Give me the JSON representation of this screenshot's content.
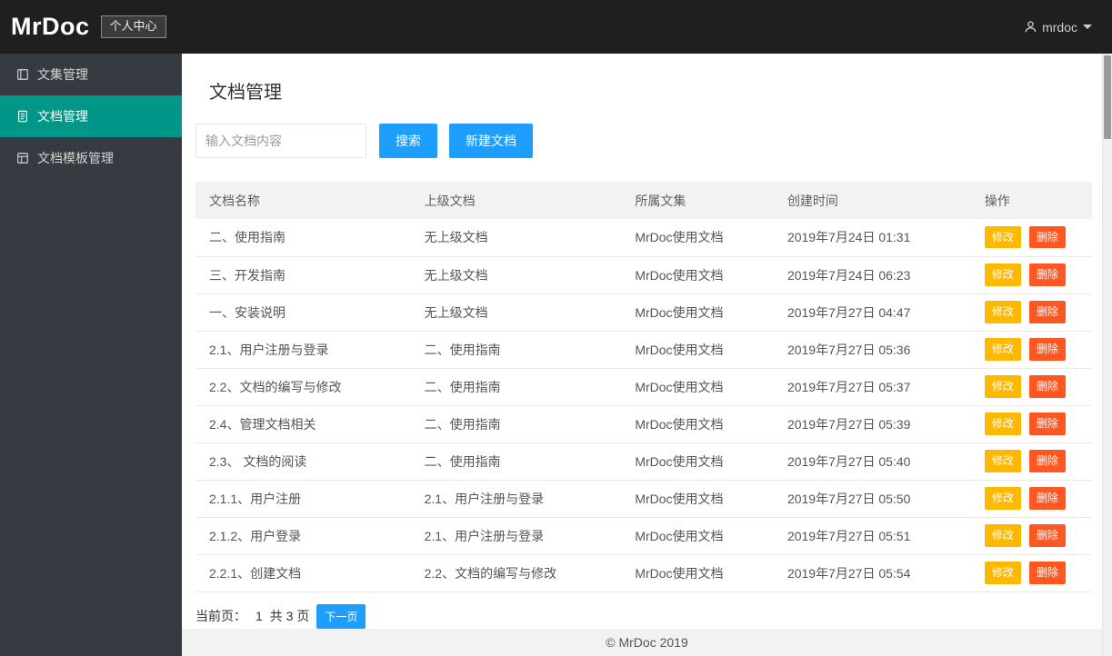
{
  "navbar": {
    "brand": "MrDoc",
    "badge": "个人中心",
    "user": "mrdoc"
  },
  "sidebar": {
    "items": [
      {
        "id": "collections",
        "label": "文集管理",
        "icon": "collection-icon",
        "active": false
      },
      {
        "id": "documents",
        "label": "文档管理",
        "icon": "document-icon",
        "active": true
      },
      {
        "id": "templates",
        "label": "文档模板管理",
        "icon": "template-icon",
        "active": false
      }
    ]
  },
  "main": {
    "title": "文档管理",
    "search": {
      "placeholder": "输入文档内容",
      "search_label": "搜索",
      "new_doc_label": "新建文档"
    },
    "table": {
      "headers": [
        "文档名称",
        "上级文档",
        "所属文集",
        "创建时间",
        "操作"
      ],
      "actions": {
        "edit": "修改",
        "delete": "删除"
      },
      "rows": [
        {
          "name": "二、使用指南",
          "parent": "无上级文档",
          "collection": "MrDoc使用文档",
          "created": "2019年7月24日 01:31"
        },
        {
          "name": "三、开发指南",
          "parent": "无上级文档",
          "collection": "MrDoc使用文档",
          "created": "2019年7月24日 06:23"
        },
        {
          "name": "一、安装说明",
          "parent": "无上级文档",
          "collection": "MrDoc使用文档",
          "created": "2019年7月27日 04:47"
        },
        {
          "name": "2.1、用户注册与登录",
          "parent": "二、使用指南",
          "collection": "MrDoc使用文档",
          "created": "2019年7月27日 05:36"
        },
        {
          "name": "2.2、文档的编写与修改",
          "parent": "二、使用指南",
          "collection": "MrDoc使用文档",
          "created": "2019年7月27日 05:37"
        },
        {
          "name": "2.4、管理文档相关",
          "parent": "二、使用指南",
          "collection": "MrDoc使用文档",
          "created": "2019年7月27日 05:39"
        },
        {
          "name": "2.3、 文档的阅读",
          "parent": "二、使用指南",
          "collection": "MrDoc使用文档",
          "created": "2019年7月27日 05:40"
        },
        {
          "name": "2.1.1、用户注册",
          "parent": "2.1、用户注册与登录",
          "collection": "MrDoc使用文档",
          "created": "2019年7月27日 05:50"
        },
        {
          "name": "2.1.2、用户登录",
          "parent": "2.1、用户注册与登录",
          "collection": "MrDoc使用文档",
          "created": "2019年7月27日 05:51"
        },
        {
          "name": "2.2.1、创建文档",
          "parent": "2.2、文档的编写与修改",
          "collection": "MrDoc使用文档",
          "created": "2019年7月27日 05:54"
        }
      ]
    },
    "pagination": {
      "label": "当前页：",
      "current": "1",
      "total": "共 3 页",
      "next_label": "下一页"
    }
  },
  "footer": {
    "copyright": "© MrDoc 2019"
  },
  "colors": {
    "accent_blue": "#1E9FFF",
    "active_teal": "#009688",
    "edit_orange": "#FFB800",
    "delete_red": "#FF5722",
    "navbar_bg": "#1f1f1f",
    "sidebar_bg": "#363b42"
  }
}
